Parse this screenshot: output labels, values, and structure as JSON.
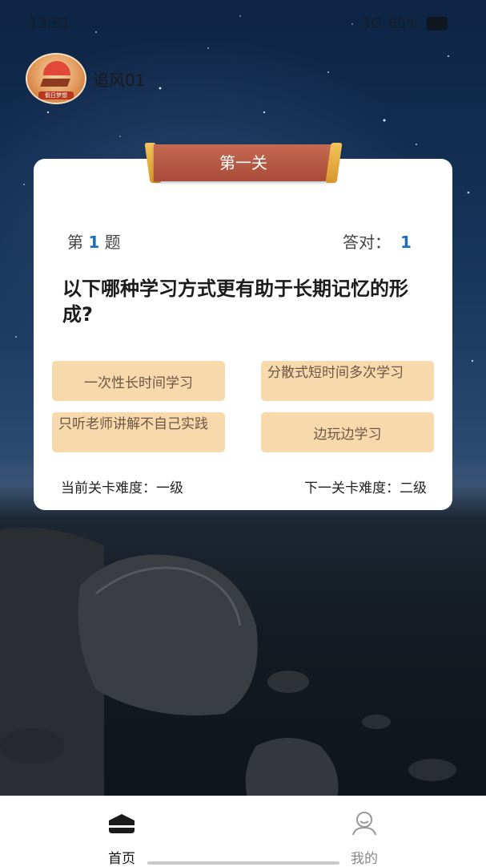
{
  "status_bar": {
    "time": "13:51",
    "network": "5G",
    "battery": "65%"
  },
  "user": {
    "name": "追风01",
    "avatar_tag": "假日梦想"
  },
  "level": {
    "banner": "第一关",
    "question_label_prefix": "第",
    "question_number": "1",
    "question_label_suffix": "题",
    "correct_label": "答对：",
    "correct_count": "1",
    "question": "以下哪种学习方式更有助于长期记忆的形成?",
    "options": [
      "一次性长时间学习",
      "分散式短时间多次学习",
      "只听老师讲解不自己实践",
      "边玩边学习"
    ],
    "current_difficulty": "当前关卡难度：一级",
    "next_difficulty": "下一关卡难度：二级"
  },
  "nav": {
    "items": [
      {
        "label": "首页",
        "icon": "home-icon",
        "active": true
      },
      {
        "label": "我的",
        "icon": "user-icon",
        "active": false
      }
    ]
  },
  "colors": {
    "banner": "#a84c39",
    "banner_edge": "#f2c45a",
    "option_bg": "#f8d9ab",
    "accent": "#1e6fb8"
  }
}
